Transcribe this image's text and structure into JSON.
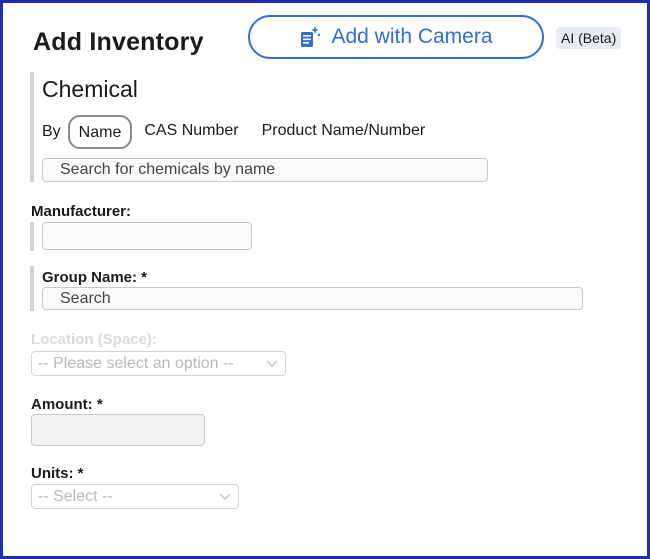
{
  "header": {
    "title": "Add Inventory",
    "camera_button_label": "Add with Camera",
    "ai_badge": "AI (Beta)"
  },
  "chemical": {
    "section_title": "Chemical",
    "search_by_label": "By",
    "tabs": [
      "Name",
      "CAS Number",
      "Product Name/Number"
    ],
    "active_tab": "Name",
    "search_placeholder": "Search for chemicals by name"
  },
  "manufacturer": {
    "label": "Manufacturer:",
    "value": ""
  },
  "group_name": {
    "label": "Group Name: *",
    "placeholder": "Search"
  },
  "location": {
    "label": "Location (Space):",
    "selected": "-- Please select an option --",
    "disabled": true
  },
  "amount": {
    "label": "Amount: *",
    "value": ""
  },
  "units": {
    "label": "Units: *",
    "selected": "-- Select --"
  },
  "colors": {
    "frame_border": "#1d2fb0",
    "accent": "#2f6fd1",
    "disabled_text": "#d9d9d9"
  },
  "icons": {
    "camera_button": "camera-scan-icon",
    "select_arrow": "chevron-down-icon"
  }
}
